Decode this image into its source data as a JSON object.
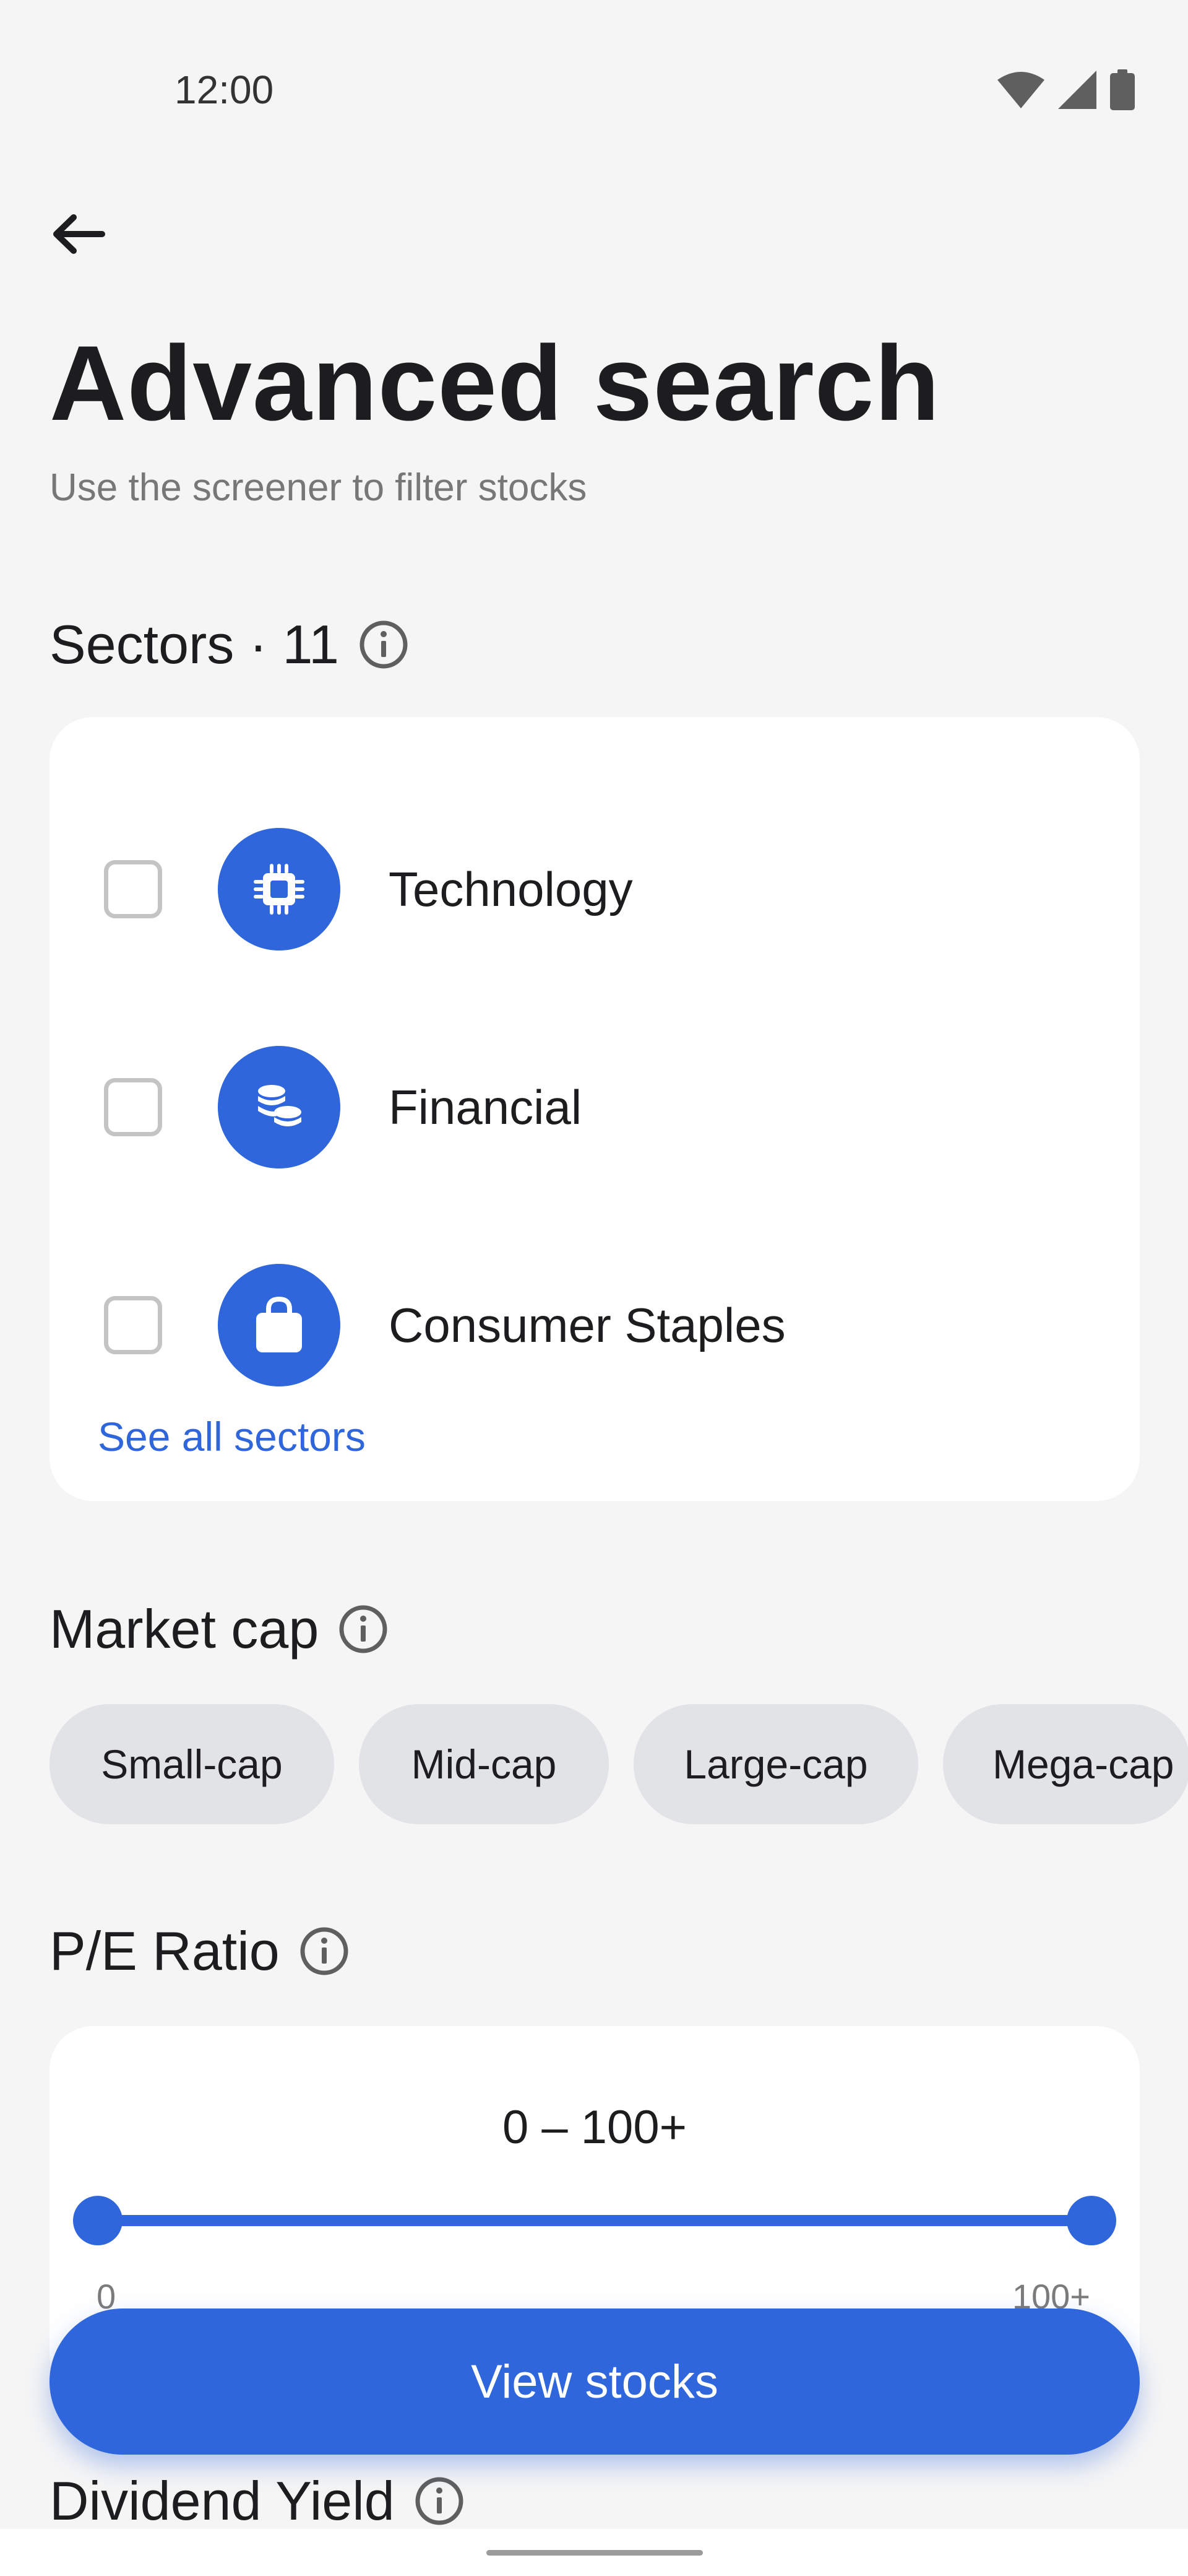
{
  "status_bar": {
    "time": "12:00",
    "icons": [
      "wifi-icon",
      "signal-icon",
      "battery-icon"
    ]
  },
  "header": {
    "back_icon": "arrow-left-icon",
    "title": "Advanced search",
    "subtitle": "Use the screener to filter stocks"
  },
  "sectors": {
    "title": "Sectors · 11",
    "items": [
      {
        "label": "Technology",
        "icon": "chip-icon",
        "checked": false
      },
      {
        "label": "Financial",
        "icon": "coins-icon",
        "checked": false
      },
      {
        "label": "Consumer Staples",
        "icon": "shopping-bag-icon",
        "checked": false
      }
    ],
    "see_all": "See all sectors"
  },
  "market_cap": {
    "title": "Market cap",
    "options": [
      "Small-cap",
      "Mid-cap",
      "Large-cap",
      "Mega-cap"
    ]
  },
  "pe_ratio": {
    "title": "P/E Ratio",
    "range_text": "0 – 100+",
    "min_label": "0",
    "max_label": "100+",
    "selected_min": 0,
    "selected_max": 1
  },
  "dividend_yield": {
    "title": "Dividend Yield"
  },
  "cta": {
    "label": "View stocks"
  },
  "colors": {
    "accent": "#2f66db",
    "chip_bg": "#e1e3e6",
    "page_bg": "#f5f5f5"
  }
}
